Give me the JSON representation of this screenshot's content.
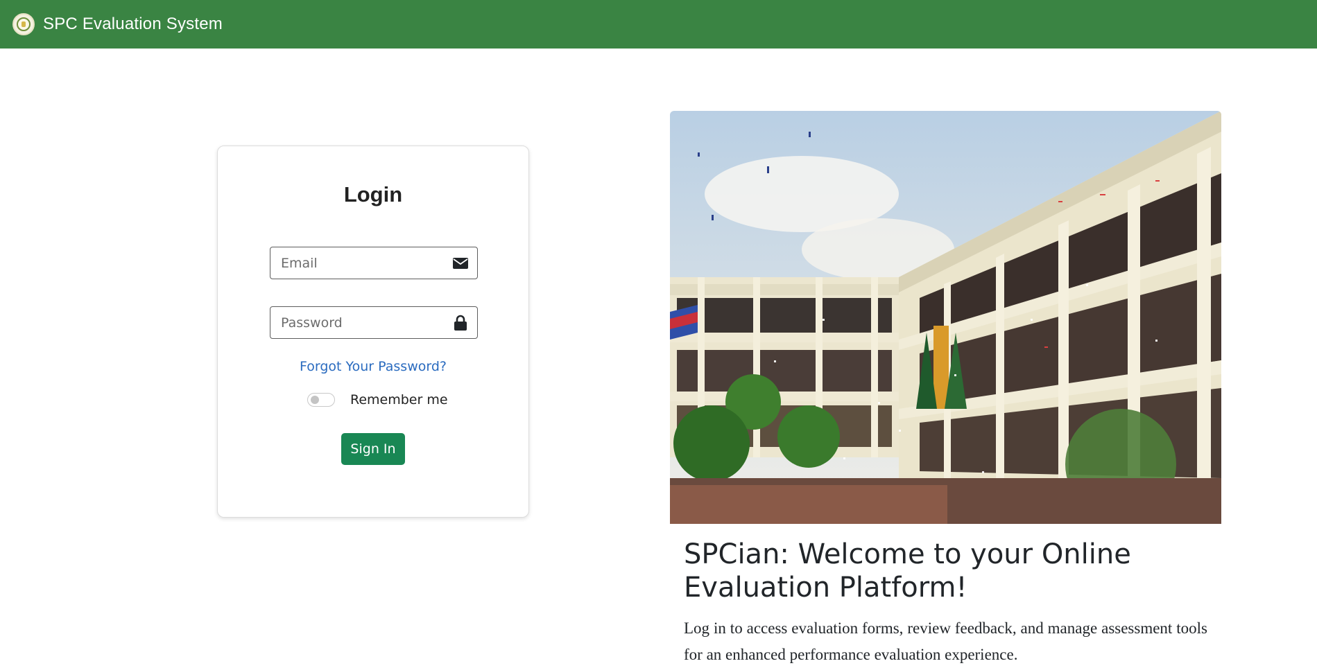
{
  "navbar": {
    "brand": "SPC Evaluation System",
    "logo_icon": "school-seal-logo",
    "color": "#3a8443"
  },
  "login": {
    "title": "Login",
    "email_placeholder": "Email",
    "email_icon": "envelope-icon",
    "password_placeholder": "Password",
    "password_icon": "lock-icon",
    "forgot_password": "Forgot Your Password?",
    "remember_me": "Remember me",
    "remember_checked": false,
    "signin_label": "Sign In",
    "signin_color": "#198754",
    "link_color": "#2a6bbf"
  },
  "hero": {
    "image_desc": "campus-building-celebration-photo",
    "title": "SPCian: Welcome to your Online Evaluation Platform!",
    "text": "Log in to access evaluation forms, review feedback, and manage assessment tools for an enhanced performance evaluation experience."
  }
}
